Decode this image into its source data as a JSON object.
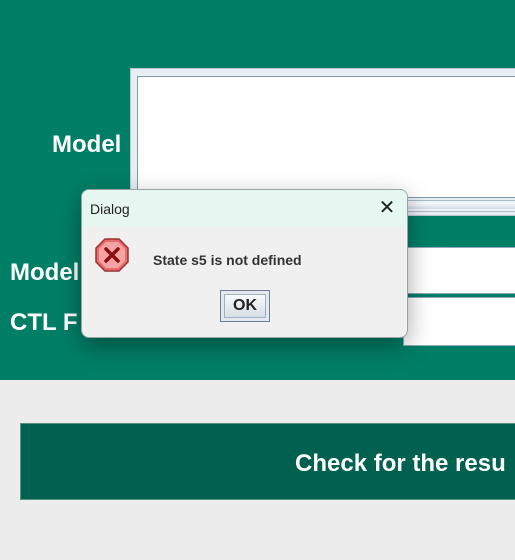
{
  "form": {
    "model_label": "Model",
    "model_state_label": "Model",
    "ctl_label": "CTL F",
    "check_button": "Check for the resu"
  },
  "dialog": {
    "title": "Dialog",
    "close_glyph": "✕",
    "message": "State s5 is not defined",
    "ok_label": "OK",
    "icon": "error-icon"
  },
  "colors": {
    "panel": "#007e66",
    "button": "#006150",
    "error": "#e04a4a"
  }
}
